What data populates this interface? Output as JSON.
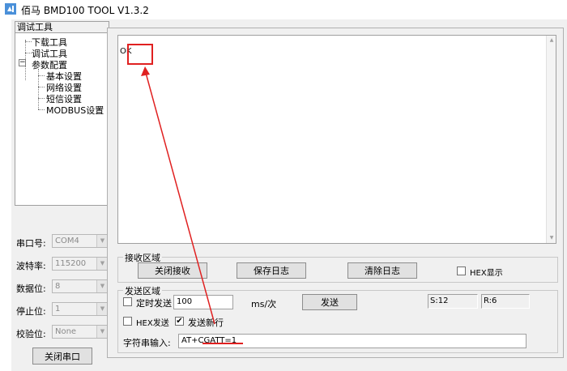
{
  "window": {
    "title": "佰马 BMD100 TOOL V1.3.2"
  },
  "tree": {
    "header": "调试工具",
    "items": [
      {
        "label": "下载工具"
      },
      {
        "label": "调试工具"
      },
      {
        "label": "参数配置",
        "expander": "⊟"
      },
      {
        "label": "基本设置"
      },
      {
        "label": "网络设置"
      },
      {
        "label": "短信设置"
      },
      {
        "label": "MODBUS设置"
      }
    ]
  },
  "port_settings": {
    "port": {
      "label": "串口号:",
      "value": "COM4"
    },
    "baud": {
      "label": "波特率:",
      "value": "115200"
    },
    "databits": {
      "label": "数据位:",
      "value": "8"
    },
    "stopbits": {
      "label": "停止位:",
      "value": "1"
    },
    "parity": {
      "label": "校验位:",
      "value": "None"
    },
    "close_port_label": "关闭串口"
  },
  "receive": {
    "content": "OK",
    "group_title": "接收区域",
    "close_receive_label": "关闭接收",
    "save_log_label": "保存日志",
    "clear_log_label": "清除日志",
    "hex_display_label": "HEX显示",
    "hex_display_checked": false
  },
  "send": {
    "group_title": "发送区域",
    "timed_send_label": "定时发送",
    "timed_send_checked": false,
    "interval_value": "100",
    "interval_unit": "ms/次",
    "send_button_label": "发送",
    "sent_count": "S:12",
    "recv_count": "R:6",
    "hex_send_label": "HEX发送",
    "hex_send_checked": false,
    "newline_label": "发送新行",
    "newline_checked": true,
    "input_label": "字符串输入:",
    "input_value": "AT+CGATT=1"
  },
  "annotation_color": "#e02020"
}
